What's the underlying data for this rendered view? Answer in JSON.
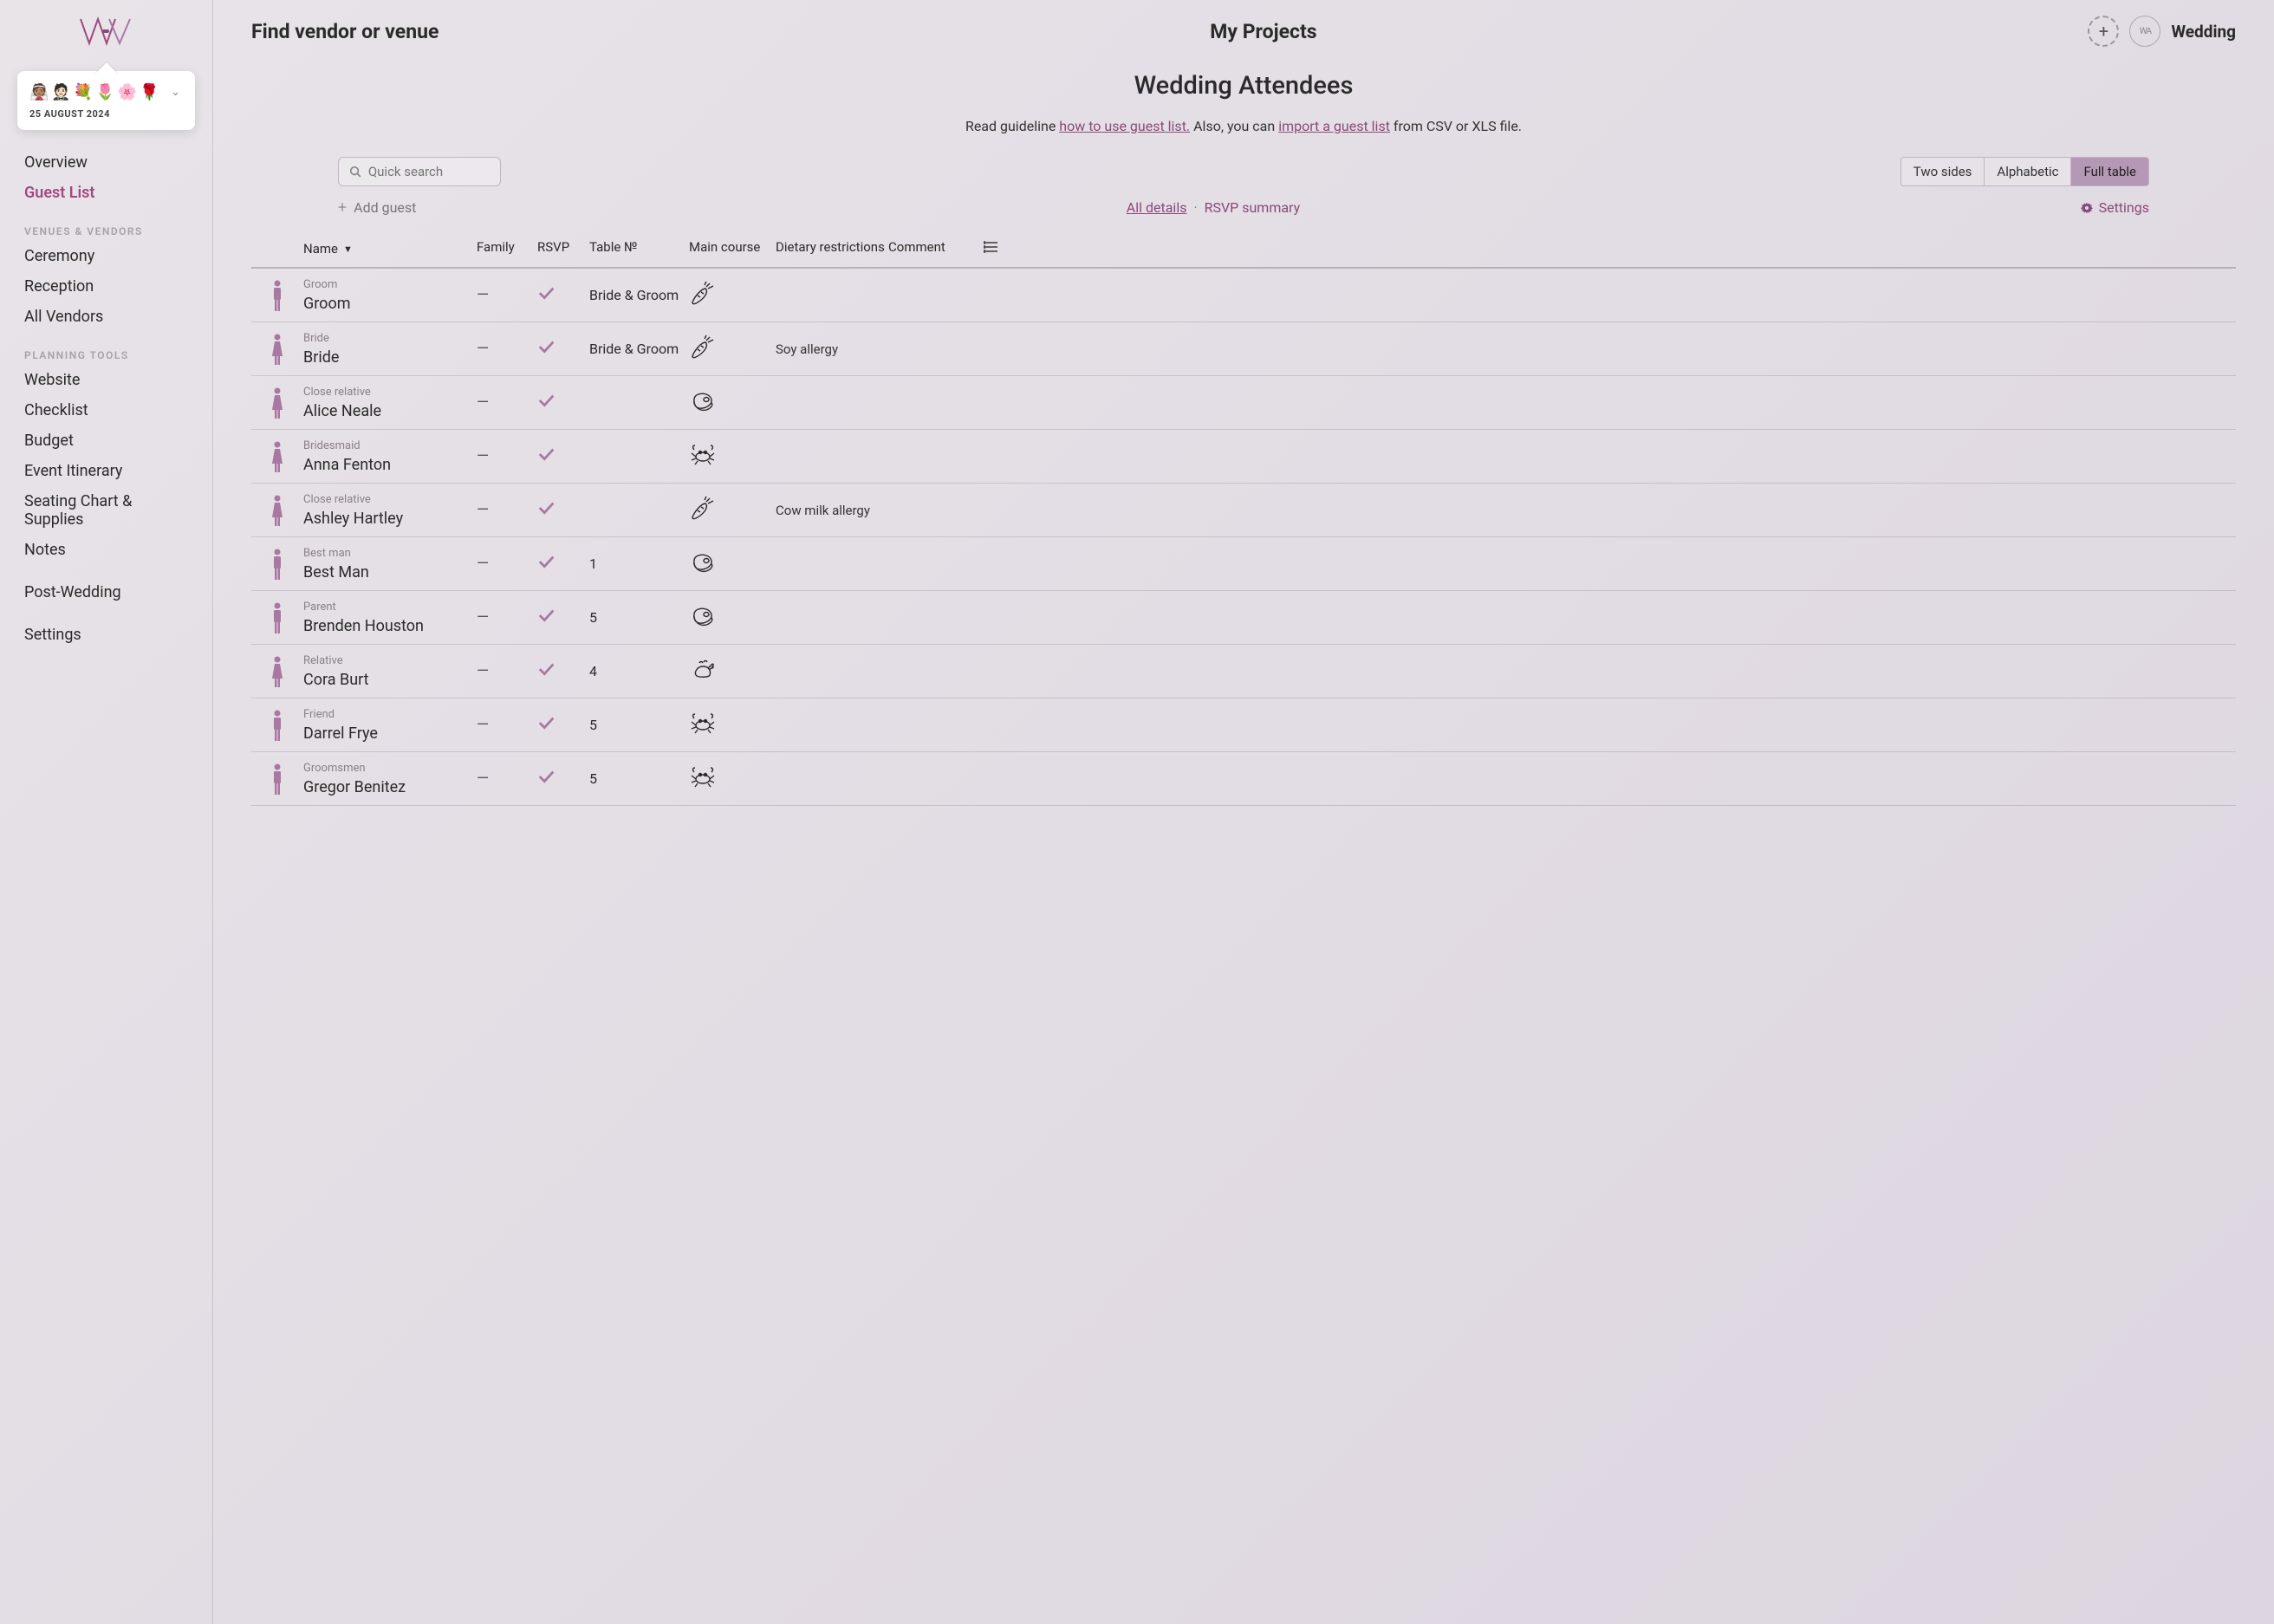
{
  "project": {
    "emojis": "👰🏽🤵🏻💐🌷🌸🌹",
    "date": "25 AUGUST 2024"
  },
  "nav": {
    "overview": "Overview",
    "guestlist": "Guest List",
    "sec_venues": "VENUES & VENDORS",
    "ceremony": "Ceremony",
    "reception": "Reception",
    "allvendors": "All Vendors",
    "sec_tools": "PLANNING TOOLS",
    "website": "Website",
    "checklist": "Checklist",
    "budget": "Budget",
    "itinerary": "Event Itinerary",
    "seating": "Seating Chart & Supplies",
    "notes": "Notes",
    "post": "Post-Wedding",
    "settings": "Settings"
  },
  "topbar": {
    "find": "Find vendor or venue",
    "projects": "My Projects",
    "wedding": "Wedding",
    "avatar": "WA"
  },
  "page": {
    "title": "Wedding Attendees",
    "guide_pre": "Read guideline ",
    "guide_link1": "how to use guest list.",
    "guide_mid": " Also, you can ",
    "guide_link2": "import a guest list",
    "guide_post": " from CSV or XLS file."
  },
  "controls": {
    "search_ph": "Quick search",
    "seg1": "Two sides",
    "seg2": "Alphabetic",
    "seg3": "Full table",
    "add": "Add guest",
    "all_details": "All details",
    "rsvp_summary": "RSVP summary",
    "settings": "Settings"
  },
  "columns": {
    "name": "Name",
    "family": "Family",
    "rsvp": "RSVP",
    "table": "Table №",
    "main": "Main course",
    "diet": "Dietary restrictions",
    "comment": "Comment"
  },
  "guests": [
    {
      "role": "Groom",
      "name": "Groom",
      "gender": "m",
      "family": "—",
      "rsvp": true,
      "table": "Bride & Groom",
      "meal": "carrot",
      "diet": ""
    },
    {
      "role": "Bride",
      "name": "Bride",
      "gender": "f",
      "family": "—",
      "rsvp": true,
      "table": "Bride & Groom",
      "meal": "carrot",
      "diet": "Soy allergy"
    },
    {
      "role": "Close relative",
      "name": "Alice Neale",
      "gender": "f",
      "family": "—",
      "rsvp": true,
      "table": "",
      "meal": "steak",
      "diet": ""
    },
    {
      "role": "Bridesmaid",
      "name": "Anna Fenton",
      "gender": "f",
      "family": "—",
      "rsvp": true,
      "table": "",
      "meal": "crab",
      "diet": ""
    },
    {
      "role": "Close relative",
      "name": "Ashley Hartley",
      "gender": "f",
      "family": "—",
      "rsvp": true,
      "table": "",
      "meal": "carrot",
      "diet": "Cow milk allergy"
    },
    {
      "role": "Best man",
      "name": "Best Man",
      "gender": "m",
      "family": "—",
      "rsvp": true,
      "table": "1",
      "meal": "steak",
      "diet": ""
    },
    {
      "role": "Parent",
      "name": "Brenden Houston",
      "gender": "m",
      "family": "—",
      "rsvp": true,
      "table": "5",
      "meal": "steak",
      "diet": ""
    },
    {
      "role": "Relative",
      "name": "Cora Burt",
      "gender": "f",
      "family": "—",
      "rsvp": true,
      "table": "4",
      "meal": "chicken",
      "diet": ""
    },
    {
      "role": "Friend",
      "name": "Darrel Frye",
      "gender": "m",
      "family": "—",
      "rsvp": true,
      "table": "5",
      "meal": "crab",
      "diet": ""
    },
    {
      "role": "Groomsmen",
      "name": "Gregor Benitez",
      "gender": "m",
      "family": "—",
      "rsvp": true,
      "table": "5",
      "meal": "crab",
      "diet": ""
    }
  ]
}
